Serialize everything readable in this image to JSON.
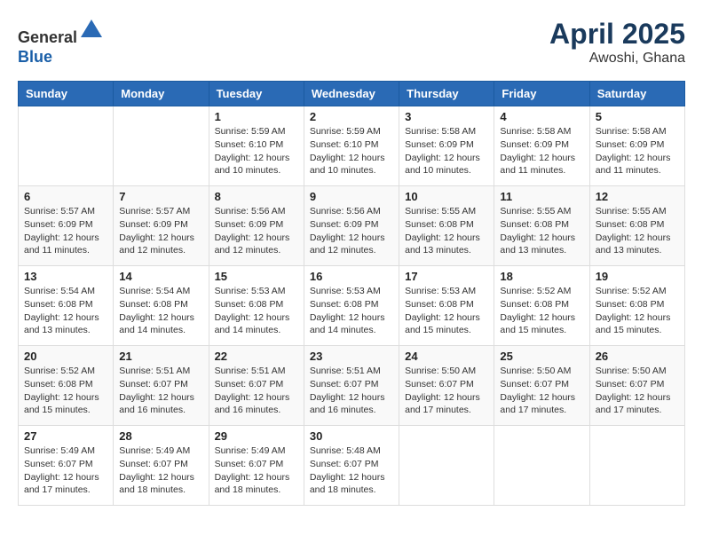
{
  "header": {
    "logo_line1": "General",
    "logo_line2": "Blue",
    "month": "April 2025",
    "location": "Awoshi, Ghana"
  },
  "weekdays": [
    "Sunday",
    "Monday",
    "Tuesday",
    "Wednesday",
    "Thursday",
    "Friday",
    "Saturday"
  ],
  "weeks": [
    [
      {
        "day": "",
        "info": ""
      },
      {
        "day": "",
        "info": ""
      },
      {
        "day": "1",
        "info": "Sunrise: 5:59 AM\nSunset: 6:10 PM\nDaylight: 12 hours and 10 minutes."
      },
      {
        "day": "2",
        "info": "Sunrise: 5:59 AM\nSunset: 6:10 PM\nDaylight: 12 hours and 10 minutes."
      },
      {
        "day": "3",
        "info": "Sunrise: 5:58 AM\nSunset: 6:09 PM\nDaylight: 12 hours and 10 minutes."
      },
      {
        "day": "4",
        "info": "Sunrise: 5:58 AM\nSunset: 6:09 PM\nDaylight: 12 hours and 11 minutes."
      },
      {
        "day": "5",
        "info": "Sunrise: 5:58 AM\nSunset: 6:09 PM\nDaylight: 12 hours and 11 minutes."
      }
    ],
    [
      {
        "day": "6",
        "info": "Sunrise: 5:57 AM\nSunset: 6:09 PM\nDaylight: 12 hours and 11 minutes."
      },
      {
        "day": "7",
        "info": "Sunrise: 5:57 AM\nSunset: 6:09 PM\nDaylight: 12 hours and 12 minutes."
      },
      {
        "day": "8",
        "info": "Sunrise: 5:56 AM\nSunset: 6:09 PM\nDaylight: 12 hours and 12 minutes."
      },
      {
        "day": "9",
        "info": "Sunrise: 5:56 AM\nSunset: 6:09 PM\nDaylight: 12 hours and 12 minutes."
      },
      {
        "day": "10",
        "info": "Sunrise: 5:55 AM\nSunset: 6:08 PM\nDaylight: 12 hours and 13 minutes."
      },
      {
        "day": "11",
        "info": "Sunrise: 5:55 AM\nSunset: 6:08 PM\nDaylight: 12 hours and 13 minutes."
      },
      {
        "day": "12",
        "info": "Sunrise: 5:55 AM\nSunset: 6:08 PM\nDaylight: 12 hours and 13 minutes."
      }
    ],
    [
      {
        "day": "13",
        "info": "Sunrise: 5:54 AM\nSunset: 6:08 PM\nDaylight: 12 hours and 13 minutes."
      },
      {
        "day": "14",
        "info": "Sunrise: 5:54 AM\nSunset: 6:08 PM\nDaylight: 12 hours and 14 minutes."
      },
      {
        "day": "15",
        "info": "Sunrise: 5:53 AM\nSunset: 6:08 PM\nDaylight: 12 hours and 14 minutes."
      },
      {
        "day": "16",
        "info": "Sunrise: 5:53 AM\nSunset: 6:08 PM\nDaylight: 12 hours and 14 minutes."
      },
      {
        "day": "17",
        "info": "Sunrise: 5:53 AM\nSunset: 6:08 PM\nDaylight: 12 hours and 15 minutes."
      },
      {
        "day": "18",
        "info": "Sunrise: 5:52 AM\nSunset: 6:08 PM\nDaylight: 12 hours and 15 minutes."
      },
      {
        "day": "19",
        "info": "Sunrise: 5:52 AM\nSunset: 6:08 PM\nDaylight: 12 hours and 15 minutes."
      }
    ],
    [
      {
        "day": "20",
        "info": "Sunrise: 5:52 AM\nSunset: 6:08 PM\nDaylight: 12 hours and 15 minutes."
      },
      {
        "day": "21",
        "info": "Sunrise: 5:51 AM\nSunset: 6:07 PM\nDaylight: 12 hours and 16 minutes."
      },
      {
        "day": "22",
        "info": "Sunrise: 5:51 AM\nSunset: 6:07 PM\nDaylight: 12 hours and 16 minutes."
      },
      {
        "day": "23",
        "info": "Sunrise: 5:51 AM\nSunset: 6:07 PM\nDaylight: 12 hours and 16 minutes."
      },
      {
        "day": "24",
        "info": "Sunrise: 5:50 AM\nSunset: 6:07 PM\nDaylight: 12 hours and 17 minutes."
      },
      {
        "day": "25",
        "info": "Sunrise: 5:50 AM\nSunset: 6:07 PM\nDaylight: 12 hours and 17 minutes."
      },
      {
        "day": "26",
        "info": "Sunrise: 5:50 AM\nSunset: 6:07 PM\nDaylight: 12 hours and 17 minutes."
      }
    ],
    [
      {
        "day": "27",
        "info": "Sunrise: 5:49 AM\nSunset: 6:07 PM\nDaylight: 12 hours and 17 minutes."
      },
      {
        "day": "28",
        "info": "Sunrise: 5:49 AM\nSunset: 6:07 PM\nDaylight: 12 hours and 18 minutes."
      },
      {
        "day": "29",
        "info": "Sunrise: 5:49 AM\nSunset: 6:07 PM\nDaylight: 12 hours and 18 minutes."
      },
      {
        "day": "30",
        "info": "Sunrise: 5:48 AM\nSunset: 6:07 PM\nDaylight: 12 hours and 18 minutes."
      },
      {
        "day": "",
        "info": ""
      },
      {
        "day": "",
        "info": ""
      },
      {
        "day": "",
        "info": ""
      }
    ]
  ]
}
